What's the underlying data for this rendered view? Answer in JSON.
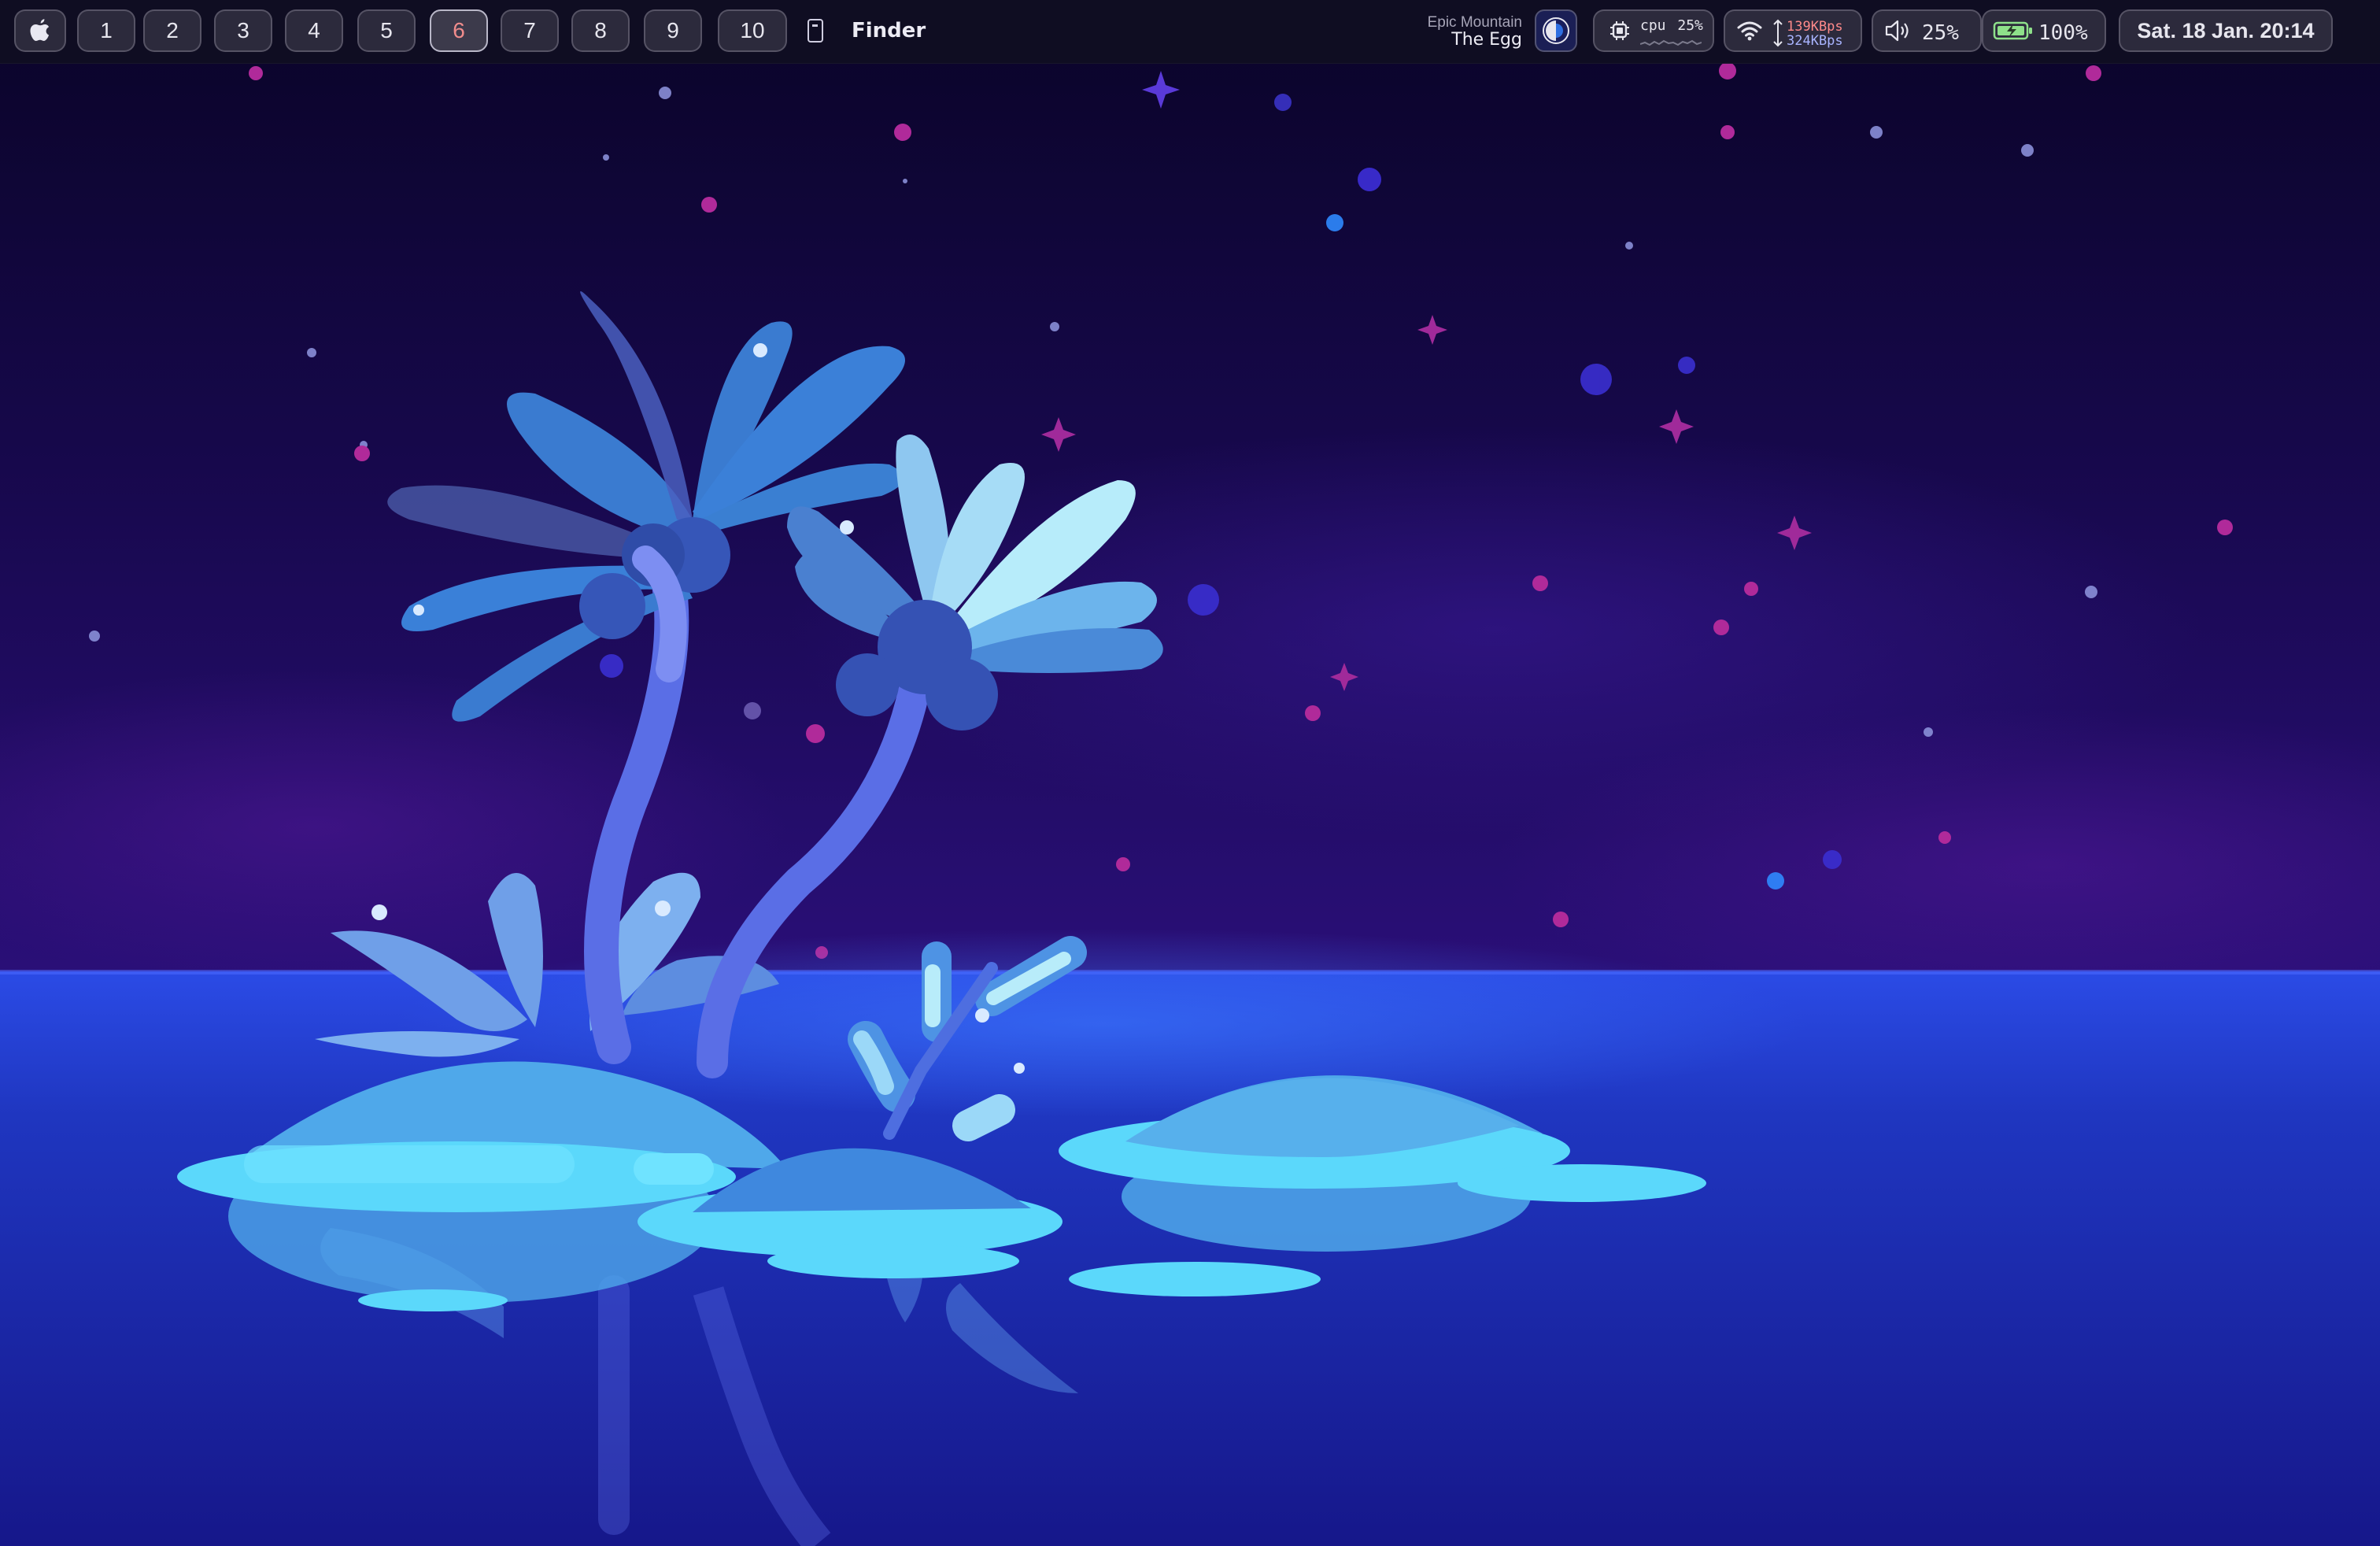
{
  "topbar": {
    "apple_icon": "apple-logo-icon",
    "workspaces": [
      {
        "label": "1",
        "active": false
      },
      {
        "label": "2",
        "active": false
      },
      {
        "label": "3",
        "active": false
      },
      {
        "label": "4",
        "active": false
      },
      {
        "label": "5",
        "active": false
      },
      {
        "label": "6",
        "active": true
      },
      {
        "label": "7",
        "active": false
      },
      {
        "label": "8",
        "active": false
      },
      {
        "label": "9",
        "active": false
      },
      {
        "label": "10",
        "active": false
      }
    ],
    "front_app": {
      "icon": "window-icon",
      "name": "Finder"
    },
    "media": {
      "artist": "Epic Mountain",
      "track": "The Egg",
      "art_icon": "album-art-icon"
    },
    "cpu": {
      "icon": "cpu-chip-icon",
      "label": "cpu",
      "value": "25%"
    },
    "network": {
      "icon": "wifi-icon",
      "upload": "139KBps",
      "download": "324KBps",
      "upload_color": "#ff8a8a",
      "download_color": "#a9b4ff"
    },
    "volume": {
      "icon": "speaker-icon",
      "value": "25%"
    },
    "battery": {
      "icon": "battery-charging-icon",
      "value": "100%",
      "color": "#8ee08a"
    },
    "clock": {
      "value": "Sat. 18 Jan. 20:14"
    }
  },
  "colors": {
    "bar_bg": "#100e22",
    "pill_bg": "#464452",
    "active_workspace_text": "#f08c8c",
    "sky_top": "#0b0530",
    "water": "#1a2aa0",
    "island": "#5dd6f8"
  }
}
